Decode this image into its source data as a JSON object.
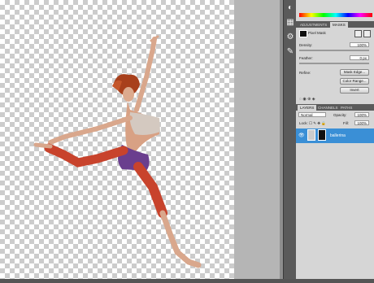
{
  "colors": {
    "accent": "#3a8fd6",
    "panel": "#d6d6d6",
    "dark": "#5a5a5a"
  },
  "masks_panel": {
    "tabs": [
      "ADJUSTMENTS",
      "MASKS"
    ],
    "title": "Pixel Mask",
    "density_label": "Density:",
    "density_value": "100%",
    "feather_label": "Feather:",
    "feather_value": "0 px",
    "refine_label": "Refine:",
    "mask_edge_button": "Mask Edge...",
    "color_range_button": "Color Range...",
    "invert_button": "Invert"
  },
  "layers_panel": {
    "tabs": [
      "LAYERS",
      "CHANNELS",
      "PATHS"
    ],
    "blend_mode": "Normal",
    "opacity_label": "Opacity:",
    "opacity_value": "100%",
    "lock_label": "Lock:",
    "fill_label": "Fill:",
    "fill_value": "100%",
    "layer_name": "ballerina"
  }
}
